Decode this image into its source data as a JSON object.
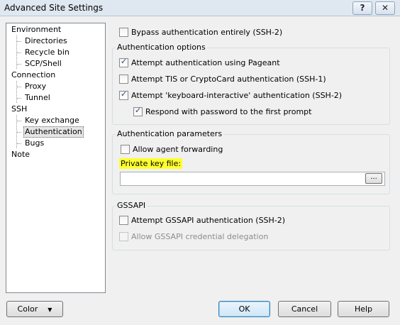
{
  "window": {
    "title": "Advanced Site Settings",
    "help_button": "?",
    "close_button": "✕"
  },
  "tree": {
    "environment": "Environment",
    "directories": "Directories",
    "recycle_bin": "Recycle bin",
    "scp_shell": "SCP/Shell",
    "connection": "Connection",
    "proxy": "Proxy",
    "tunnel": "Tunnel",
    "ssh": "SSH",
    "key_exchange": "Key exchange",
    "authentication": "Authentication",
    "bugs": "Bugs",
    "note": "Note"
  },
  "bypass": {
    "label": "Bypass authentication entirely (SSH-2)",
    "checked": false
  },
  "auth_options": {
    "title": "Authentication options",
    "pageant": {
      "label": "Attempt authentication using Pageant",
      "checked": true
    },
    "tis": {
      "label": "Attempt TIS or CryptoCard authentication (SSH-1)",
      "checked": false
    },
    "keyboard": {
      "label": "Attempt 'keyboard-interactive' authentication (SSH-2)",
      "checked": true
    },
    "respond": {
      "label": "Respond with password to the first prompt",
      "checked": true
    }
  },
  "auth_params": {
    "title": "Authentication parameters",
    "agent_forwarding": {
      "label": "Allow agent forwarding",
      "checked": false
    },
    "private_key_label": "Private key file:",
    "private_key_value": "",
    "browse_label": "..."
  },
  "gssapi": {
    "title": "GSSAPI",
    "attempt": {
      "label": "Attempt GSSAPI authentication (SSH-2)",
      "checked": false
    },
    "delegation": {
      "label": "Allow GSSAPI credential delegation",
      "checked": false,
      "disabled": true
    }
  },
  "buttons": {
    "color": "Color",
    "ok": "OK",
    "cancel": "Cancel",
    "help": "Help"
  }
}
